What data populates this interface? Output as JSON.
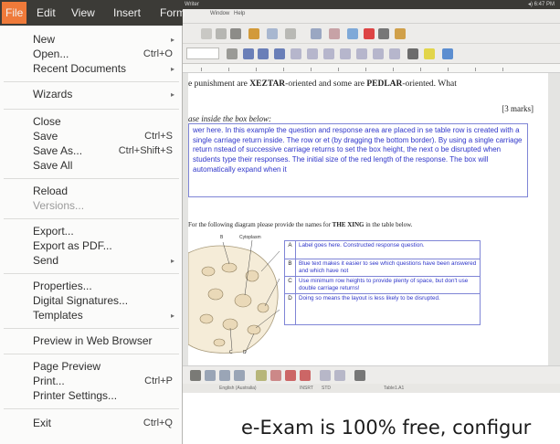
{
  "topbar": {
    "app": "Writer",
    "status": "◂) 6:47 PM"
  },
  "menubar": {
    "items": [
      "File",
      "Edit",
      "View",
      "Insert",
      "Form"
    ]
  },
  "writer_menubar": [
    "Window",
    "Help"
  ],
  "file_menu": {
    "new": "New",
    "open": "Open...",
    "open_acc": "Ctrl+O",
    "recent": "Recent Documents",
    "wizards": "Wizards",
    "close": "Close",
    "save": "Save",
    "save_acc": "Ctrl+S",
    "save_as": "Save As...",
    "save_as_acc": "Ctrl+Shift+S",
    "save_all": "Save All",
    "reload": "Reload",
    "versions": "Versions...",
    "export": "Export...",
    "export_pdf": "Export as PDF...",
    "send": "Send",
    "properties": "Properties...",
    "digital_signatures": "Digital Signatures...",
    "templates": "Templates",
    "preview_web": "Preview in Web Browser",
    "page_preview": "Page Preview",
    "print": "Print...",
    "print_acc": "Ctrl+P",
    "printer_settings": "Printer Settings...",
    "exit": "Exit",
    "exit_acc": "Ctrl+Q"
  },
  "document": {
    "question_pre": "e punishment are ",
    "xeztar": "XEZTAR",
    "question_mid": "-oriented and some are ",
    "pedlar": "PEDLAR",
    "question_post": "-oriented. What",
    "marks": "[3 marks]",
    "answer_label": "ase inside the box below:",
    "answer_box": "wer here. In this example the question and response area are placed in se table row is created with a single carriage return inside. The row or et (by dragging the bottom border). By using a single carriage return nstead of successive carriage returns to set the box height, the next o be disrupted when students type their responses. The initial size of the red length of the response. The box will automatically expand when it",
    "diagram_question_pre": "For the following diagram please provide the names for ",
    "diagram_question_bold": "THE XING",
    "diagram_question_post": " in the table below.",
    "diagram_labels": {
      "b": "B",
      "cytoplasm": "Cytoplasm",
      "c": "C",
      "d": "D"
    },
    "table_rows": [
      {
        "letter": "A",
        "text": "Label goes here. Constructed response question."
      },
      {
        "letter": "B",
        "text": "Blue text makes it easier to see which questions have been answered and which have not"
      },
      {
        "letter": "C",
        "text": "Use minimum row heights to provide plenty of space, but don't use double carriage returns!"
      },
      {
        "letter": "D",
        "text": "Doing so means the layout is less likely to be disrupted."
      }
    ]
  },
  "statusbar": {
    "language": "English (Australia)",
    "mode": "INSRT",
    "std": "STD",
    "table": "Table1.A1"
  },
  "caption": "e-Exam is 100% free, configur",
  "colors": {
    "menu_highlight": "#ef7a3a",
    "answer_blue": "#2f36c9",
    "ubuntu_dark": "#3c3b37"
  }
}
